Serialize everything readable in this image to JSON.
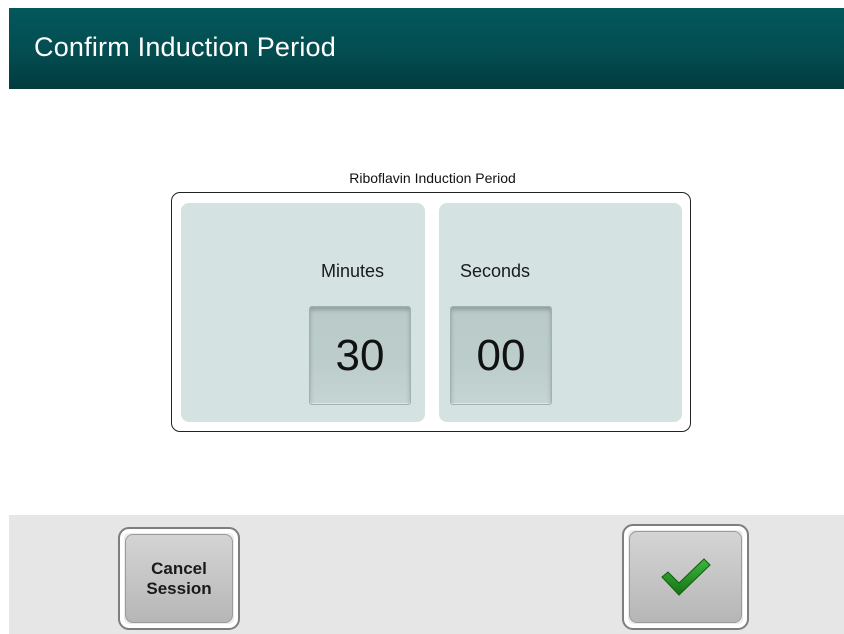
{
  "header": {
    "title": "Confirm Induction Period"
  },
  "induction": {
    "group_label": "Riboflavin Induction Period",
    "minutes_label": "Minutes",
    "minutes_value": "30",
    "seconds_label": "Seconds",
    "seconds_value": "00"
  },
  "footer": {
    "cancel_label": "Cancel\nSession",
    "confirm_icon": "check-icon"
  },
  "colors": {
    "header_bg": "#03545a",
    "panel_bg": "#d4e2e1",
    "check_green": "#1f8a1f"
  }
}
